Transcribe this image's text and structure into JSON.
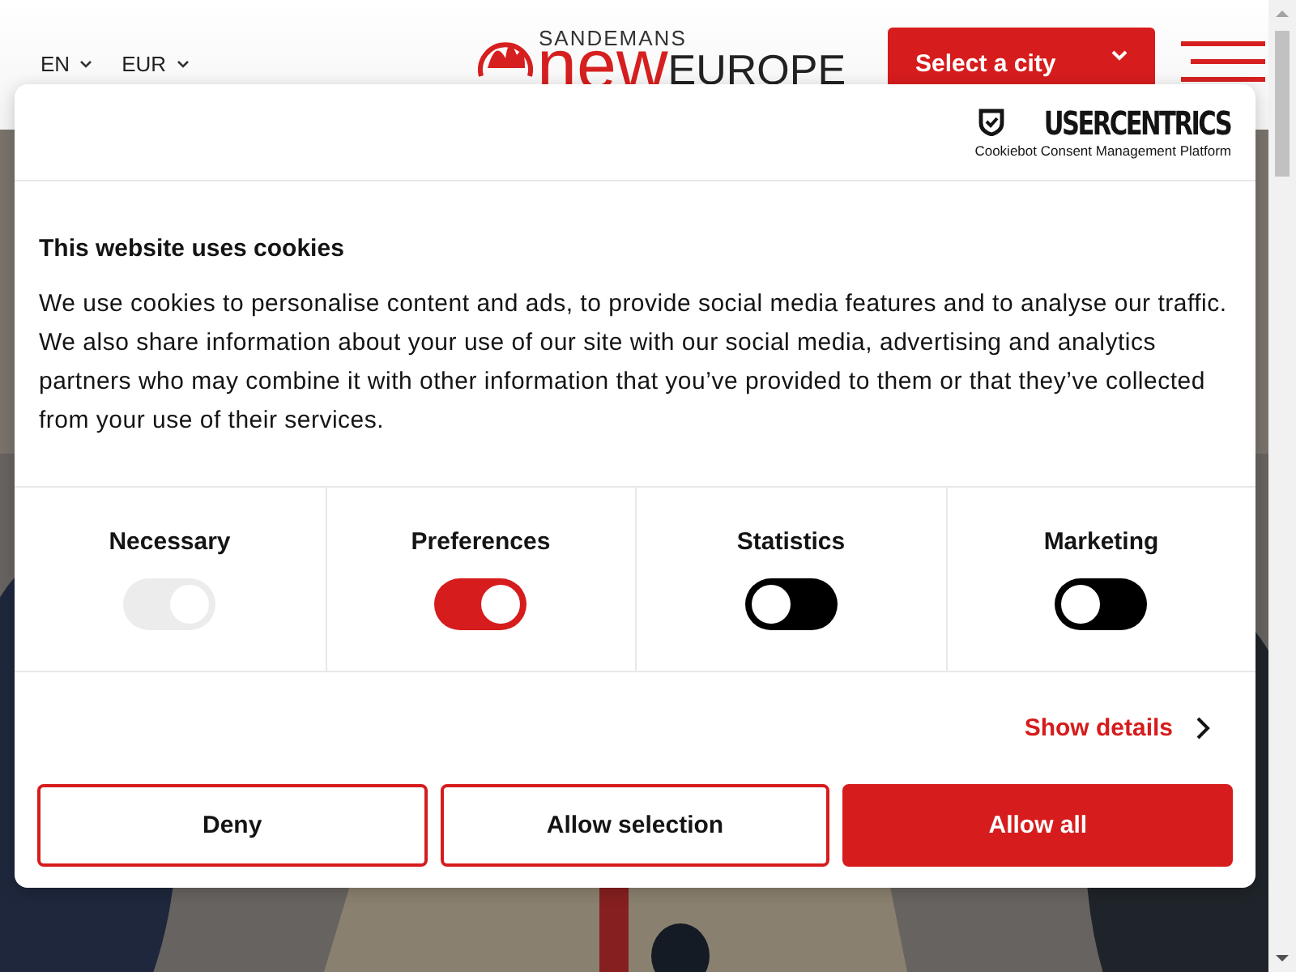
{
  "header": {
    "language": "EN",
    "currency": "EUR",
    "logo": {
      "brand": "SANDEMANS",
      "word_1": "new",
      "word_2": "EUROPE"
    },
    "city_select": "Select a city"
  },
  "cookie_dialog": {
    "provider": {
      "name": "USERCENTRICS",
      "tagline": "Cookiebot Consent Management Platform"
    },
    "title": "This website uses cookies",
    "body": "We use cookies to personalise content and ads, to provide social media features and to analyse our traffic. We also share information about your use of our site with our social media, advertising and analytics partners who may combine it with other information that you’ve provided to them or that they’ve collected from your use of their services.",
    "categories": [
      {
        "label": "Necessary",
        "on": true,
        "disabled": true
      },
      {
        "label": "Preferences",
        "on": true,
        "disabled": false
      },
      {
        "label": "Statistics",
        "on": false,
        "disabled": false
      },
      {
        "label": "Marketing",
        "on": false,
        "disabled": false
      }
    ],
    "details_link": "Show details",
    "buttons": [
      {
        "label": "Deny",
        "kind": "outline"
      },
      {
        "label": "Allow selection",
        "kind": "outline"
      },
      {
        "label": "Allow all",
        "kind": "primary"
      }
    ]
  }
}
